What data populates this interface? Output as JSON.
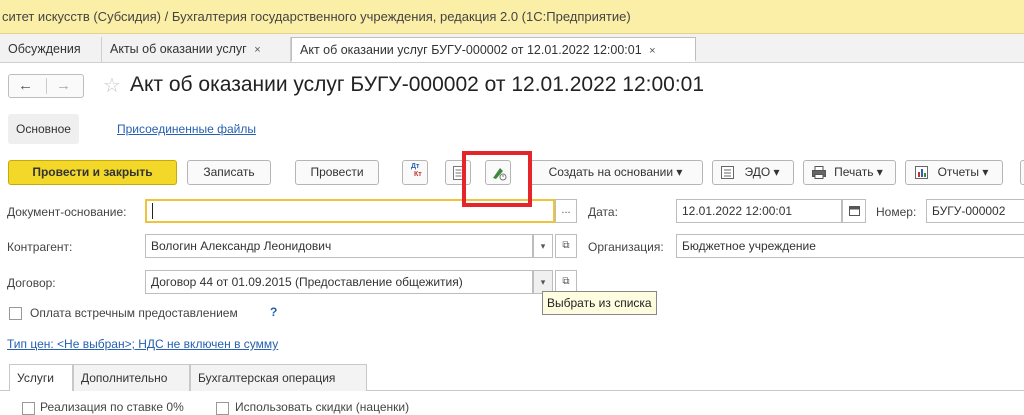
{
  "window": {
    "title": "ситет искусств (Субсидия) / Бухгалтерия государственного учреждения, редакция 2.0  (1С:Предприятие)"
  },
  "tabs": [
    {
      "label": "Обсуждения"
    },
    {
      "label": "Акты об оказании услуг",
      "close": "×"
    },
    {
      "label": "Акт об оказании услуг БУГУ-000002 от 12.01.2022 12:00:01",
      "close": "×"
    }
  ],
  "header": {
    "back": "←",
    "forward": "→",
    "star": "☆",
    "title": "Акт об оказании услуг БУГУ-000002 от 12.01.2022 12:00:01"
  },
  "sections": {
    "main": "Основное",
    "attached": "Присоединенные файлы"
  },
  "toolbar": {
    "post_close": "Провести и закрыть",
    "save": "Записать",
    "post": "Провести",
    "dt_kt_top": "Дт",
    "dt_kt_bottom": "Кт",
    "create_based": "Создать на основании ▾",
    "edo": "ЭДО ▾",
    "print": "Печать ▾",
    "reports": "Отчеты ▾"
  },
  "form": {
    "basis_label": "Документ-основание:",
    "basis_value": "",
    "date_label": "Дата:",
    "date_value": "12.01.2022 12:00:01",
    "number_label": "Номер:",
    "number_value": "БУГУ-000002",
    "counterparty_label": "Контрагент:",
    "counterparty_value": "Вологин Александр Леонидович",
    "organization_label": "Организация:",
    "organization_value": "Бюджетное учреждение",
    "contract_label": "Договор:",
    "contract_value": "Договор 44 от 01.09.2015 (Предоставление общежития)",
    "counter_payment_label": "Оплата встречным предоставлением",
    "help": "?",
    "price_type_link": "Тип цен: <Не выбран>; НДС не включен в сумму",
    "ellipsis": "...",
    "dropdown": "▾",
    "open": "⧉"
  },
  "tooltip": "Выбрать из списка",
  "subtabs": [
    {
      "label": "Услуги"
    },
    {
      "label": "Дополнительно"
    },
    {
      "label": "Бухгалтерская операция"
    }
  ],
  "options": {
    "zero_rate": "Реализация по ставке 0%",
    "use_discounts": "Использовать скидки (наценки)"
  },
  "colors": {
    "primary_button": "#f3d829",
    "title_bar": "#fbeea6",
    "link": "#2660b0",
    "highlight_box": "#e4252a"
  }
}
